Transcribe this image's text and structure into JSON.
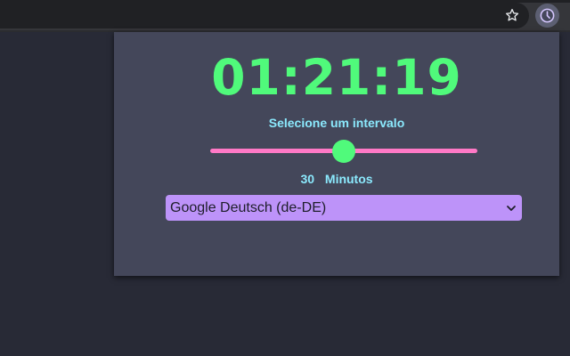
{
  "browser": {
    "bookmark_icon": "star-icon",
    "extension_icon": "clock-icon"
  },
  "popup": {
    "timer": "01:21:19",
    "interval_label": "Selecione um intervalo",
    "slider": {
      "value": 30,
      "level": 0.5
    },
    "minutes_value": "30",
    "minutes_unit": "Minutos",
    "voice_select": {
      "selected": "Google Deutsch (de-DE)"
    }
  },
  "colors": {
    "background": "#282a36",
    "popup": "#44475a",
    "timer": "#50fa7b",
    "label": "#8be9fd",
    "slider_track": "#ff79c6",
    "slider_thumb": "#50fa7b",
    "select": "#bd93f9"
  }
}
